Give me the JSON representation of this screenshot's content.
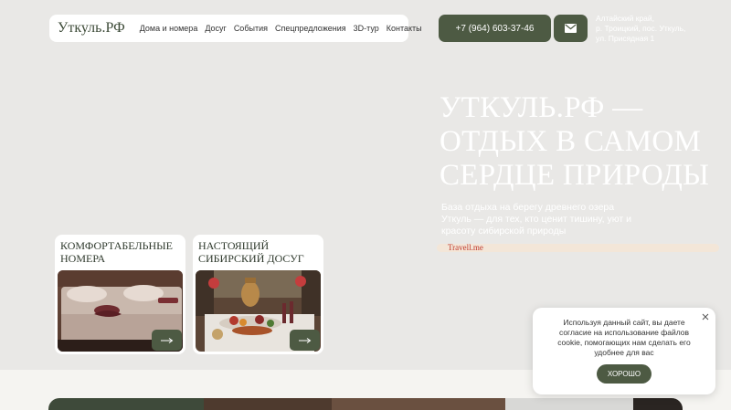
{
  "header": {
    "logo": "Уткуль.РФ",
    "nav": [
      "Дома и номера",
      "Досуг",
      "События",
      "Спецпредложения",
      "3D-тур",
      "Контакты"
    ],
    "phone": "+7 (964) 603-37-46",
    "mail_icon": "envelope-icon",
    "address_lines": [
      "Алтайский край,",
      "р. Троицкий, пос. Уткуль,",
      "ул. Присядная 1"
    ]
  },
  "hero": {
    "title_lines": [
      "Уткуль.рф —",
      "отдых в самом",
      "сердце природы"
    ],
    "subtitle_lines": [
      "База отдыха на берегу древнего озера",
      "Уткуль — для тех, кто ценит тишину, уют и",
      "красоту сибирской природы"
    ],
    "watermark": "Travell.me"
  },
  "cards": [
    {
      "title_lines": [
        "Комфортабельные",
        "номера"
      ],
      "image": "bedroom-photo",
      "arrow_icon": "arrow-right-icon"
    },
    {
      "title_lines": [
        "Настоящий",
        "сибирский досуг"
      ],
      "image": "feast-table-photo",
      "arrow_icon": "arrow-right-icon"
    }
  ],
  "cookie": {
    "text_lines": [
      "Используя данный сайт, вы даете",
      "согласие на использование файлов",
      "cookie, помогающих нам сделать его",
      "удобнее для вас"
    ],
    "ok_label": "ХОРОШО",
    "close_icon": "close-icon"
  },
  "colors": {
    "accent": "#4d5a43",
    "background": "#e9e8e6",
    "card_bg": "#ffffff"
  }
}
